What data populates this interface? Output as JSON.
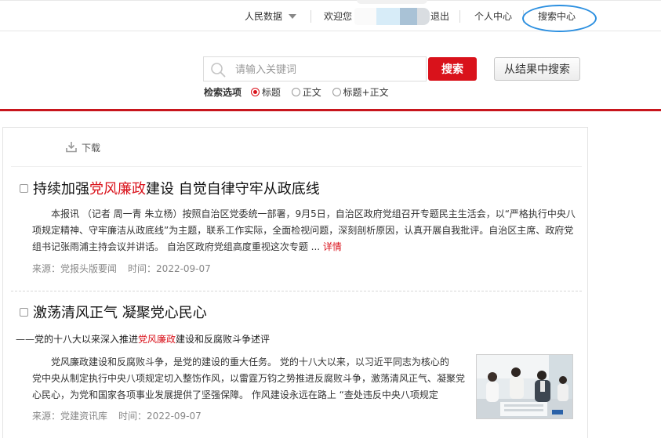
{
  "topbar": {
    "data_menu": "人民数据",
    "welcome": "欢迎您",
    "logout": "退出",
    "personal": "个人中心",
    "search_center": "搜索中心"
  },
  "search": {
    "placeholder": "请输入关键词",
    "button": "搜索",
    "refine_button": "从结果中搜索",
    "options_label": "检索选项",
    "options": [
      {
        "label": "标题",
        "selected": true
      },
      {
        "label": "正文",
        "selected": false
      },
      {
        "label": "标题+正文",
        "selected": false
      }
    ]
  },
  "toolbar": {
    "download": "下载"
  },
  "results": [
    {
      "title_pre": "持续加强",
      "title_hl": "党风廉政",
      "title_post": "建设 自觉自律守牢从政底线",
      "body_lines": [
        "本报讯 （记者 周一青 朱立杨）按照自治区党委统一部署，9月5日，自治区政府党组召开专题民主生活会，以“严格执行中央八",
        "项规定精神、守牢廉洁从政底线”为主题，联系工作实际，全面检视问题，深刻剖析原因，认真开展自我批评。自治区主席、政府党",
        "组书记张雨浦主持会议并讲话。       自治区政府党组高度重视这次专题 ... "
      ],
      "more": "详情",
      "source_label": "来源：",
      "source": "党报头版要闻",
      "time_label": "时间：",
      "time": "2022-09-07"
    },
    {
      "title": "激荡清风正气 凝聚党心民心",
      "subtitle_pre": "——党的十八大以来深入推进",
      "subtitle_hl": "党风廉政",
      "subtitle_post": "建设和反腐败斗争述评",
      "body_lines": [
        "党风廉政建设和反腐败斗争，是党的建设的重大任务。       党的十八大以来，以习近平同志为核心的",
        "党中央从制定执行中央八项规定切入整饬作风，以雷霆万钧之势推进反腐败斗争，激荡清风正气、凝聚党",
        "心民心，为党和国家各项事业发展提供了坚强保障。       作风建设永远在路上     “查处违反中央八项规定"
      ],
      "source_label": "来源：",
      "source": "党建资讯库",
      "time_label": "时间：",
      "time": "2022-09-07"
    }
  ],
  "colors": {
    "accent": "#d9121b",
    "rule": "#c8161d",
    "circle": "#2b8fe0"
  }
}
